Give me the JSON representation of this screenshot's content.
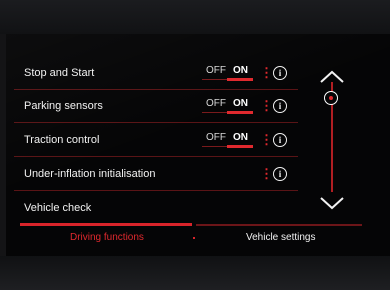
{
  "settings": [
    {
      "label": "Stop and Start",
      "off": "OFF",
      "on": "ON",
      "state": "ON"
    },
    {
      "label": "Parking sensors",
      "off": "OFF",
      "on": "ON",
      "state": "ON"
    },
    {
      "label": "Traction control",
      "off": "OFF",
      "on": "ON",
      "state": "ON"
    },
    {
      "label": "Under-inflation initialisation"
    },
    {
      "label": "Vehicle check"
    }
  ],
  "tabs": {
    "active": "Driving functions",
    "inactive": "Vehicle settings"
  },
  "colors": {
    "accent": "#e0292e",
    "text": "#f2f2f2",
    "background": "#050506"
  },
  "icons": {
    "info": "info-icon",
    "menu": "kebab-menu-icon",
    "scroll_up": "chevron-up-icon",
    "scroll_down": "chevron-down-icon"
  }
}
